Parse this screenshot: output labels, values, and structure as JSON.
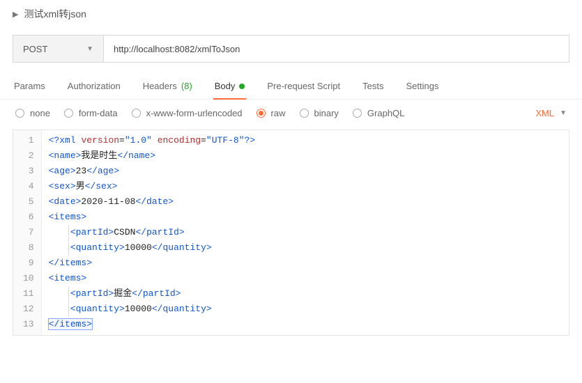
{
  "header": {
    "title": "测试xml转json"
  },
  "request": {
    "method": "POST",
    "url": "http://localhost:8082/xmlToJson"
  },
  "tabs": {
    "params": "Params",
    "authorization": "Authorization",
    "headers_label": "Headers",
    "headers_count": "(8)",
    "body": "Body",
    "prerequest": "Pre-request Script",
    "tests": "Tests",
    "settings": "Settings"
  },
  "body_types": {
    "none": "none",
    "formdata": "form-data",
    "xwww": "x-www-form-urlencoded",
    "raw": "raw",
    "binary": "binary",
    "graphql": "GraphQL"
  },
  "lang": "XML",
  "code": {
    "lines": [
      {
        "n": 1,
        "ind": 0,
        "tokens": [
          [
            "pi",
            "<?xml"
          ],
          [
            "txt",
            " "
          ],
          [
            "attr",
            "version"
          ],
          [
            "txt",
            "="
          ],
          [
            "val",
            "\"1.0\""
          ],
          [
            "txt",
            " "
          ],
          [
            "attr",
            "encoding"
          ],
          [
            "txt",
            "="
          ],
          [
            "val",
            "\"UTF-8\""
          ],
          [
            "pi",
            "?>"
          ]
        ]
      },
      {
        "n": 2,
        "ind": 0,
        "tokens": [
          [
            "tag",
            "<name>"
          ],
          [
            "txt",
            "我是时生"
          ],
          [
            "tag",
            "</name>"
          ]
        ]
      },
      {
        "n": 3,
        "ind": 0,
        "tokens": [
          [
            "tag",
            "<age>"
          ],
          [
            "txt",
            "23"
          ],
          [
            "tag",
            "</age>"
          ]
        ]
      },
      {
        "n": 4,
        "ind": 0,
        "tokens": [
          [
            "tag",
            "<sex>"
          ],
          [
            "txt",
            "男"
          ],
          [
            "tag",
            "</sex>"
          ]
        ]
      },
      {
        "n": 5,
        "ind": 0,
        "tokens": [
          [
            "tag",
            "<date>"
          ],
          [
            "txt",
            "2020-11-08"
          ],
          [
            "tag",
            "</date>"
          ]
        ]
      },
      {
        "n": 6,
        "ind": 0,
        "tokens": [
          [
            "tag",
            "<items>"
          ]
        ]
      },
      {
        "n": 7,
        "ind": 1,
        "tokens": [
          [
            "tag",
            "<partId>"
          ],
          [
            "txt",
            "CSDN"
          ],
          [
            "tag",
            "</partId>"
          ]
        ]
      },
      {
        "n": 8,
        "ind": 1,
        "tokens": [
          [
            "tag",
            "<quantity>"
          ],
          [
            "txt",
            "10000"
          ],
          [
            "tag",
            "</quantity>"
          ]
        ]
      },
      {
        "n": 9,
        "ind": 0,
        "tokens": [
          [
            "tag",
            "</items>"
          ]
        ]
      },
      {
        "n": 10,
        "ind": 0,
        "tokens": [
          [
            "tag",
            "<items>"
          ]
        ]
      },
      {
        "n": 11,
        "ind": 1,
        "tokens": [
          [
            "tag",
            "<partId>"
          ],
          [
            "txt",
            "掘金"
          ],
          [
            "tag",
            "</partId>"
          ]
        ]
      },
      {
        "n": 12,
        "ind": 1,
        "tokens": [
          [
            "tag",
            "<quantity>"
          ],
          [
            "txt",
            "10000"
          ],
          [
            "tag",
            "</quantity>"
          ]
        ]
      },
      {
        "n": 13,
        "ind": 0,
        "sel": true,
        "tokens": [
          [
            "tag",
            "</items>"
          ]
        ]
      }
    ]
  }
}
